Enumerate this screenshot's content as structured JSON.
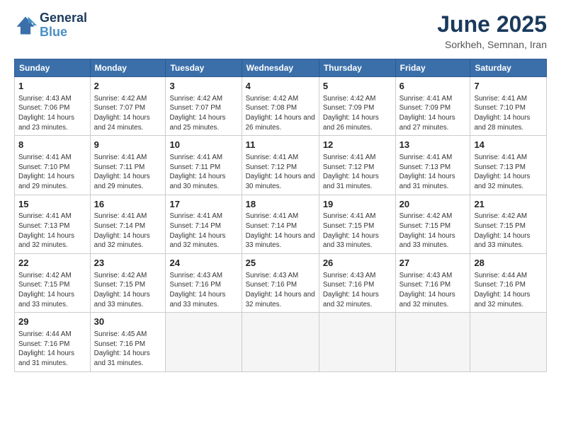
{
  "logo": {
    "line1": "General",
    "line2": "Blue"
  },
  "title": "June 2025",
  "subtitle": "Sorkheh, Semnan, Iran",
  "days_of_week": [
    "Sunday",
    "Monday",
    "Tuesday",
    "Wednesday",
    "Thursday",
    "Friday",
    "Saturday"
  ],
  "weeks": [
    [
      {
        "num": "1",
        "sunrise": "4:43 AM",
        "sunset": "7:06 PM",
        "daylight": "14 hours and 23 minutes."
      },
      {
        "num": "2",
        "sunrise": "4:42 AM",
        "sunset": "7:07 PM",
        "daylight": "14 hours and 24 minutes."
      },
      {
        "num": "3",
        "sunrise": "4:42 AM",
        "sunset": "7:07 PM",
        "daylight": "14 hours and 25 minutes."
      },
      {
        "num": "4",
        "sunrise": "4:42 AM",
        "sunset": "7:08 PM",
        "daylight": "14 hours and 26 minutes."
      },
      {
        "num": "5",
        "sunrise": "4:42 AM",
        "sunset": "7:09 PM",
        "daylight": "14 hours and 26 minutes."
      },
      {
        "num": "6",
        "sunrise": "4:41 AM",
        "sunset": "7:09 PM",
        "daylight": "14 hours and 27 minutes."
      },
      {
        "num": "7",
        "sunrise": "4:41 AM",
        "sunset": "7:10 PM",
        "daylight": "14 hours and 28 minutes."
      }
    ],
    [
      {
        "num": "8",
        "sunrise": "4:41 AM",
        "sunset": "7:10 PM",
        "daylight": "14 hours and 29 minutes."
      },
      {
        "num": "9",
        "sunrise": "4:41 AM",
        "sunset": "7:11 PM",
        "daylight": "14 hours and 29 minutes."
      },
      {
        "num": "10",
        "sunrise": "4:41 AM",
        "sunset": "7:11 PM",
        "daylight": "14 hours and 30 minutes."
      },
      {
        "num": "11",
        "sunrise": "4:41 AM",
        "sunset": "7:12 PM",
        "daylight": "14 hours and 30 minutes."
      },
      {
        "num": "12",
        "sunrise": "4:41 AM",
        "sunset": "7:12 PM",
        "daylight": "14 hours and 31 minutes."
      },
      {
        "num": "13",
        "sunrise": "4:41 AM",
        "sunset": "7:13 PM",
        "daylight": "14 hours and 31 minutes."
      },
      {
        "num": "14",
        "sunrise": "4:41 AM",
        "sunset": "7:13 PM",
        "daylight": "14 hours and 32 minutes."
      }
    ],
    [
      {
        "num": "15",
        "sunrise": "4:41 AM",
        "sunset": "7:13 PM",
        "daylight": "14 hours and 32 minutes."
      },
      {
        "num": "16",
        "sunrise": "4:41 AM",
        "sunset": "7:14 PM",
        "daylight": "14 hours and 32 minutes."
      },
      {
        "num": "17",
        "sunrise": "4:41 AM",
        "sunset": "7:14 PM",
        "daylight": "14 hours and 32 minutes."
      },
      {
        "num": "18",
        "sunrise": "4:41 AM",
        "sunset": "7:14 PM",
        "daylight": "14 hours and 33 minutes."
      },
      {
        "num": "19",
        "sunrise": "4:41 AM",
        "sunset": "7:15 PM",
        "daylight": "14 hours and 33 minutes."
      },
      {
        "num": "20",
        "sunrise": "4:42 AM",
        "sunset": "7:15 PM",
        "daylight": "14 hours and 33 minutes."
      },
      {
        "num": "21",
        "sunrise": "4:42 AM",
        "sunset": "7:15 PM",
        "daylight": "14 hours and 33 minutes."
      }
    ],
    [
      {
        "num": "22",
        "sunrise": "4:42 AM",
        "sunset": "7:15 PM",
        "daylight": "14 hours and 33 minutes."
      },
      {
        "num": "23",
        "sunrise": "4:42 AM",
        "sunset": "7:15 PM",
        "daylight": "14 hours and 33 minutes."
      },
      {
        "num": "24",
        "sunrise": "4:43 AM",
        "sunset": "7:16 PM",
        "daylight": "14 hours and 33 minutes."
      },
      {
        "num": "25",
        "sunrise": "4:43 AM",
        "sunset": "7:16 PM",
        "daylight": "14 hours and 32 minutes."
      },
      {
        "num": "26",
        "sunrise": "4:43 AM",
        "sunset": "7:16 PM",
        "daylight": "14 hours and 32 minutes."
      },
      {
        "num": "27",
        "sunrise": "4:43 AM",
        "sunset": "7:16 PM",
        "daylight": "14 hours and 32 minutes."
      },
      {
        "num": "28",
        "sunrise": "4:44 AM",
        "sunset": "7:16 PM",
        "daylight": "14 hours and 32 minutes."
      }
    ],
    [
      {
        "num": "29",
        "sunrise": "4:44 AM",
        "sunset": "7:16 PM",
        "daylight": "14 hours and 31 minutes."
      },
      {
        "num": "30",
        "sunrise": "4:45 AM",
        "sunset": "7:16 PM",
        "daylight": "14 hours and 31 minutes."
      },
      null,
      null,
      null,
      null,
      null
    ]
  ]
}
